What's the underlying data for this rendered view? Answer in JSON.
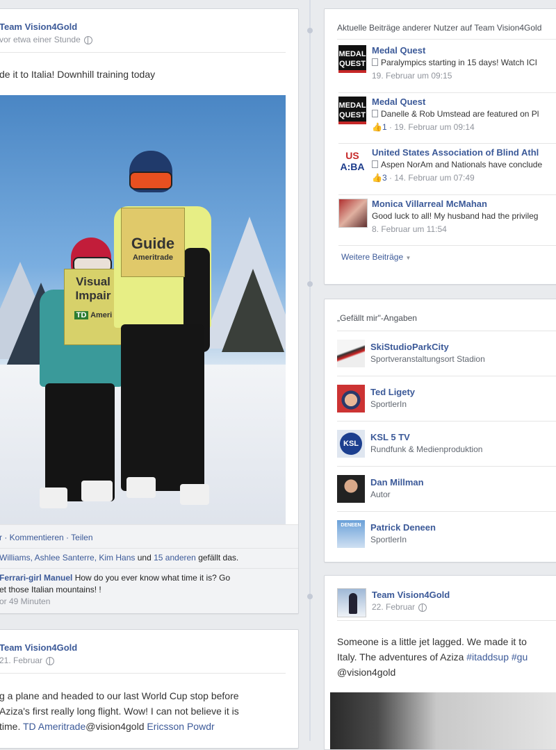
{
  "left_post": {
    "author": "Team Vision4Gold",
    "time": "vor etwa einer Stunde",
    "text": "de it to Italia! Downhill training today",
    "photo_bibs": {
      "guide": "Guide",
      "ameritrade": "Ameritrade",
      "visual": "Visual",
      "impaired": "Impair",
      "td": "TD",
      "ameritrade2": "Ameri"
    },
    "actions": "r · Kommentieren · Teilen",
    "likes_prefix": "Williams, Ashlee Santerre, Kim Hans",
    "likes_mid": "und",
    "likes_link": "15 anderen",
    "likes_suffix": "gefällt das.",
    "comment_author": "Ferrari-girl Manuel",
    "comment_text_1": "How do you ever know what time it is? Go",
    "comment_text_2": "et those Italian mountains! !",
    "comment_time": "or 49 Minuten"
  },
  "left_post2": {
    "author": "Team Vision4Gold",
    "time": "21. Februar",
    "line1": "g a plane and headed to our last World Cup stop before",
    "line2": "Aziza's first really long flight. Wow! I can not believe it is",
    "line3_prefix": "time.",
    "line3_link1": "TD Ameritrade",
    "line3_mid": "@vision4gold",
    "line3_link2": "Ericsson Powdr"
  },
  "recent_posts": {
    "header": "Aktuelle Beiträge anderer Nutzer auf Team Vision4Gold",
    "items": [
      {
        "name": "Medal Quest",
        "text": "Paralympics starting in 15 days! Watch ICI",
        "meta": "19. Februar um 09:15",
        "likes": ""
      },
      {
        "name": "Medal Quest",
        "text": "Danelle & Rob Umstead are featured on Pl",
        "meta": "· 19. Februar um 09:14",
        "likes": "1"
      },
      {
        "name": "United States Association of Blind Athl",
        "text": "Aspen NorAm and Nationals have conclude",
        "meta": "· 14. Februar um 07:49",
        "likes": "3"
      },
      {
        "name": "Monica Villarreal McMahan",
        "text": "Good luck to all! My husband had the privileg",
        "meta": "8. Februar um 11:54",
        "likes": ""
      }
    ],
    "more": "Weitere Beiträge"
  },
  "likes_box": {
    "header": "„Gefällt mir\"-Angaben",
    "items": [
      {
        "name": "SkiStudioParkCity",
        "category": "Sportveranstaltungsort Stadion"
      },
      {
        "name": "Ted Ligety",
        "category": "SportlerIn"
      },
      {
        "name": "KSL 5 TV",
        "category": "Rundfunk & Medienproduktion"
      },
      {
        "name": "Dan Millman",
        "category": "Autor"
      },
      {
        "name": "Patrick Deneen",
        "category": "SportlerIn"
      }
    ]
  },
  "right_post": {
    "author": "Team Vision4Gold",
    "time": "22. Februar",
    "line1": "Someone is a little jet lagged. We made it to",
    "line2_prefix": "Italy. The adventures of Aziza",
    "line2_tag1": "#itaddsup",
    "line2_tag2": "#gu",
    "line3": "@vision4gold"
  },
  "logos": {
    "medal_quest_line1": "MEDAL",
    "medal_quest_line2": "QUEST",
    "usaba_line1": "US",
    "usaba_line2": "A:BA",
    "ksl": "KSL",
    "deneen": "DENEEN"
  },
  "colors": {
    "link": "#3b5998",
    "meta": "#90949c",
    "page_bg": "#e9ebee"
  }
}
